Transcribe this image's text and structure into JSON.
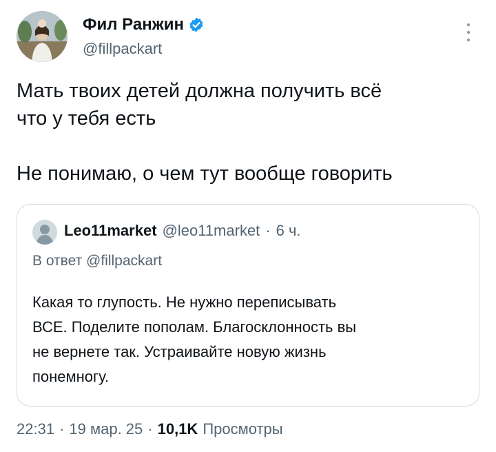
{
  "author": {
    "name": "Фил Ранжин",
    "handle": "@fillpackart",
    "verified": true,
    "avatar_icon": "profile-photo",
    "verified_icon": "verified-badge-icon",
    "verified_color": "#1d9bf0"
  },
  "more_icon": "more-vertical-icon",
  "tweet": {
    "line1": "Мать твоих детей должна получить всё",
    "line2": "что у тебя есть",
    "line3": "Не понимаю, о чем тут вообще говорить"
  },
  "quote": {
    "name": "Leo11market",
    "handle": "@leo11market",
    "sep": "·",
    "time": "6 ч.",
    "reply_to": "В ответ @fillpackart",
    "text_line1": "Какая то глупость. Не нужно переписывать",
    "text_line2": "ВСЕ. Поделите пополам. Благосклонность вы",
    "text_line3": "не вернете так. Устраивайте новую жизнь",
    "text_line4": "понемногу.",
    "avatar_icon": "default-avatar-icon"
  },
  "meta": {
    "time": "22:31",
    "sep1": "·",
    "date": "19 мар. 25",
    "sep2": "·",
    "views_count": "10,1K",
    "views_label": "Просмотры"
  },
  "colors": {
    "text": "#0f1419",
    "secondary": "#536471",
    "border": "#d4dbe1",
    "accent": "#1d9bf0"
  }
}
